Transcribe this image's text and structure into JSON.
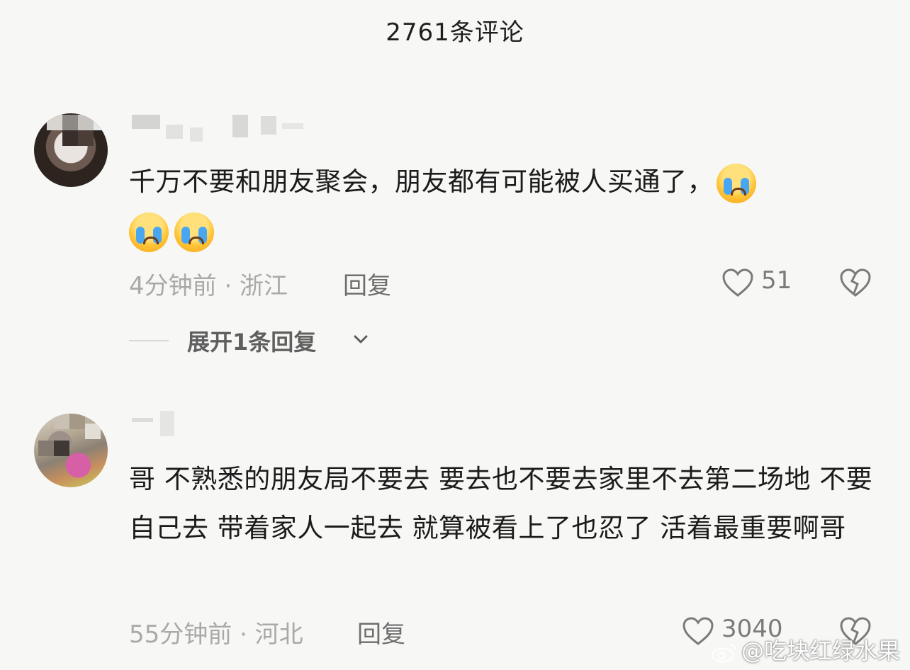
{
  "header": {
    "title": "2761条评论"
  },
  "comments": [
    {
      "content": "千万不要和朋友聚会，朋友都有可能被人买通了，",
      "emoji_icon": "loudly-crying-face-icon",
      "time": "4分钟前 · 浙江",
      "reply_label": "回复",
      "likes": "51",
      "expand_label": "展开1条回复"
    },
    {
      "content": "哥 不熟悉的朋友局不要去 要去也不要去家里不去第二场地 不要自己去 带着家人一起去 就算被看上了也忍了 活着最重要啊哥",
      "time": "55分钟前 · 河北",
      "reply_label": "回复",
      "likes": "3040"
    }
  ],
  "watermark": {
    "text": "@吃块红绿水果"
  },
  "colors": {
    "background": "#f7f7f5",
    "text": "#1b1b1b",
    "meta": "#a9a9a9",
    "icon": "#7b7b7b"
  }
}
